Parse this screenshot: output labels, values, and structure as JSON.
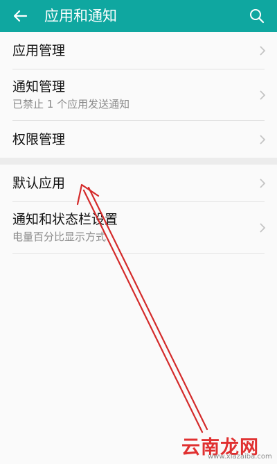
{
  "header": {
    "title": "应用和通知",
    "background": "#0fa7a0",
    "back_icon": "arrow-left-icon",
    "search_icon": "search-icon"
  },
  "items": [
    {
      "label": "应用管理"
    },
    {
      "label": "通知管理",
      "subtitle": "已禁止 1 个应用发送通知"
    },
    {
      "label": "权限管理"
    },
    {
      "label": "默认应用"
    },
    {
      "label": "通知和状态栏设置",
      "subtitle": "电量百分比显示方式"
    }
  ],
  "chevron_icon": "chevron-right-icon",
  "annotation": {
    "arrow_color": "#d42a2a"
  },
  "watermark": {
    "text": "云南龙网",
    "url": "www.xiazaiba.com"
  }
}
